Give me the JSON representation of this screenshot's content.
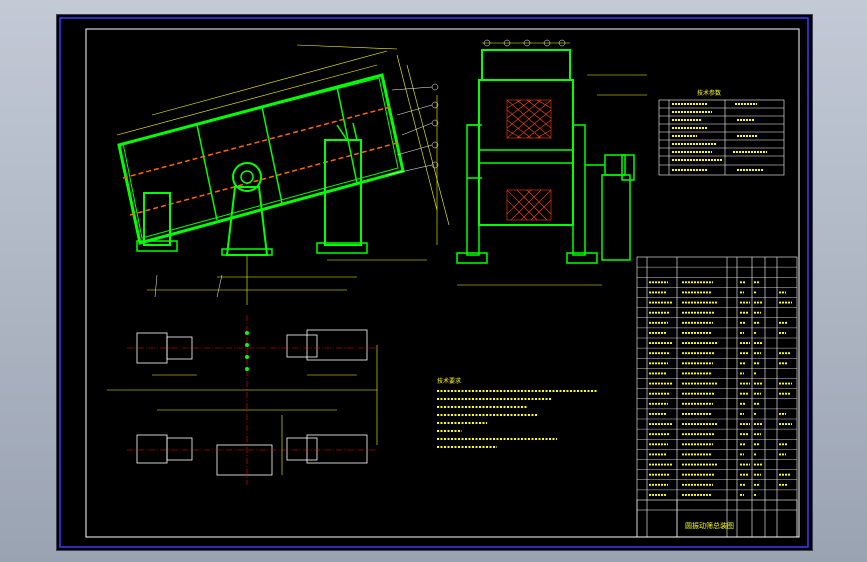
{
  "drawing": {
    "title": "圆振动筛总装图",
    "notes_heading": "技术要求",
    "table_header": "技术参数",
    "rows": 24
  },
  "colors": {
    "background": "#000000",
    "border": "#3b3bff",
    "machine": "#00ff00",
    "dimension": "#ffff00",
    "annotation": "#ffffff",
    "centerline": "#ff0000"
  }
}
